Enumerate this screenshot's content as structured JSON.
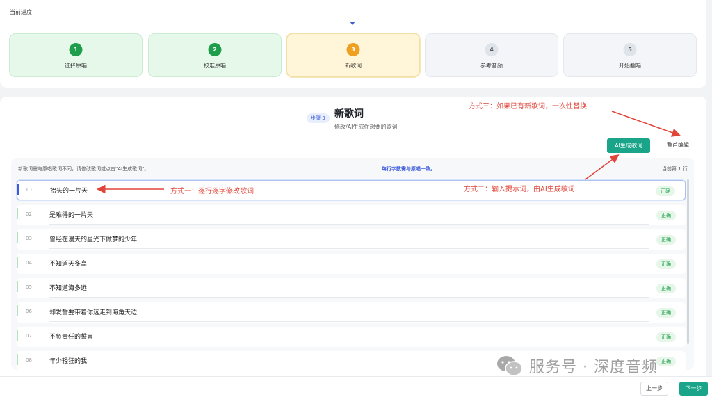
{
  "progress": {
    "title": "当前进度",
    "steps": [
      {
        "num": "1",
        "label": "选择原唱"
      },
      {
        "num": "2",
        "label": "校准原唱"
      },
      {
        "num": "3",
        "label": "新歌词"
      },
      {
        "num": "4",
        "label": "参考音频"
      },
      {
        "num": "5",
        "label": "开始翻唱"
      }
    ]
  },
  "section": {
    "badge": "步骤 3",
    "title": "新歌词",
    "subtitle": "修改/AI生成你想要的歌词"
  },
  "annotations": {
    "method1": "方式一：逐行逐字修改歌词",
    "method2": "方式二：输入提示词，由AI生成歌词",
    "method3": "方式三：如果已有新歌词，一次性替换"
  },
  "buttons": {
    "ai_generate": "AI生成歌词",
    "edit_all": "整首编辑",
    "prev": "上一步",
    "next": "下一步"
  },
  "info": {
    "left": "新歌词需与原唱歌词不同，请修改歌词或点击\"AI生成歌词\"。",
    "center": "每行字数需与原唱一致。",
    "right": "当前第 1 行"
  },
  "lyrics": [
    {
      "index": "01",
      "text": "抬头的一片天",
      "status": "正确"
    },
    {
      "index": "02",
      "text": "是难得的一片天",
      "status": "正确"
    },
    {
      "index": "03",
      "text": "曾经在漫天的星光下做梦的少年",
      "status": "正确"
    },
    {
      "index": "04",
      "text": "不知道天多高",
      "status": "正确"
    },
    {
      "index": "05",
      "text": "不知道海多远",
      "status": "正确"
    },
    {
      "index": "06",
      "text": "却发誓要带着你远走到海角天边",
      "status": "正确"
    },
    {
      "index": "07",
      "text": "不负责任的誓言",
      "status": "正确"
    },
    {
      "index": "08",
      "text": "年少轻狂的我",
      "status": "正确"
    }
  ],
  "watermark": {
    "text": "服务号 · 深度音频",
    "icon": "wechat-icon"
  },
  "colors": {
    "accent": "#1aa58a",
    "annotation": "#e0453a",
    "active_step": "#f0a020",
    "done_step": "#1e9e4a"
  }
}
